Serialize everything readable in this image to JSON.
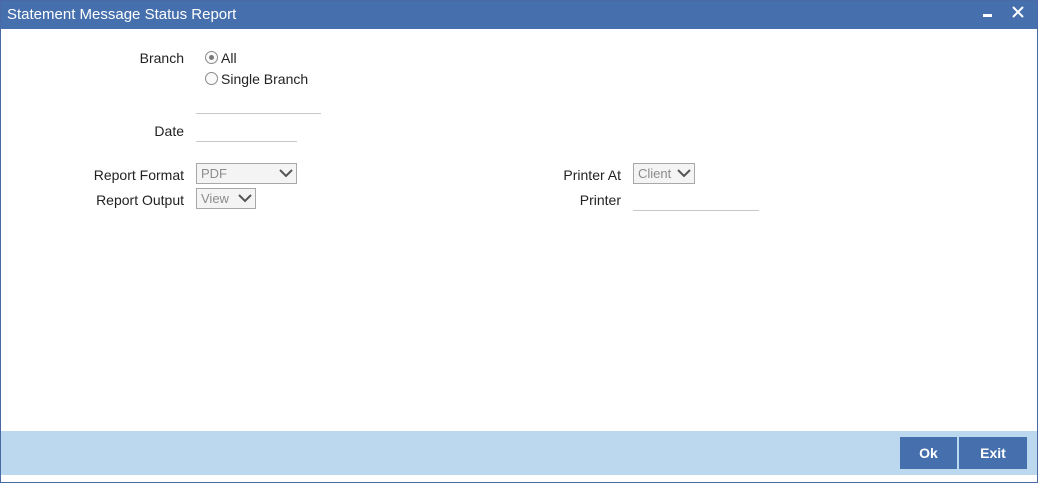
{
  "window": {
    "title": "Statement Message Status Report"
  },
  "branch": {
    "label": "Branch",
    "options": [
      {
        "label": "All",
        "selected": true
      },
      {
        "label": "Single Branch",
        "selected": false
      }
    ],
    "branch_code_value": ""
  },
  "date": {
    "label": "Date",
    "value": ""
  },
  "report_format": {
    "label": "Report Format",
    "selected": "PDF"
  },
  "report_output": {
    "label": "Report Output",
    "selected": "View"
  },
  "printer_at": {
    "label": "Printer At",
    "selected": "Client"
  },
  "printer": {
    "label": "Printer",
    "value": ""
  },
  "footer": {
    "ok_label": "Ok",
    "exit_label": "Exit"
  },
  "colors": {
    "titlebar": "#4670ad",
    "footer": "#bcd8ee",
    "button": "#4670ad"
  }
}
